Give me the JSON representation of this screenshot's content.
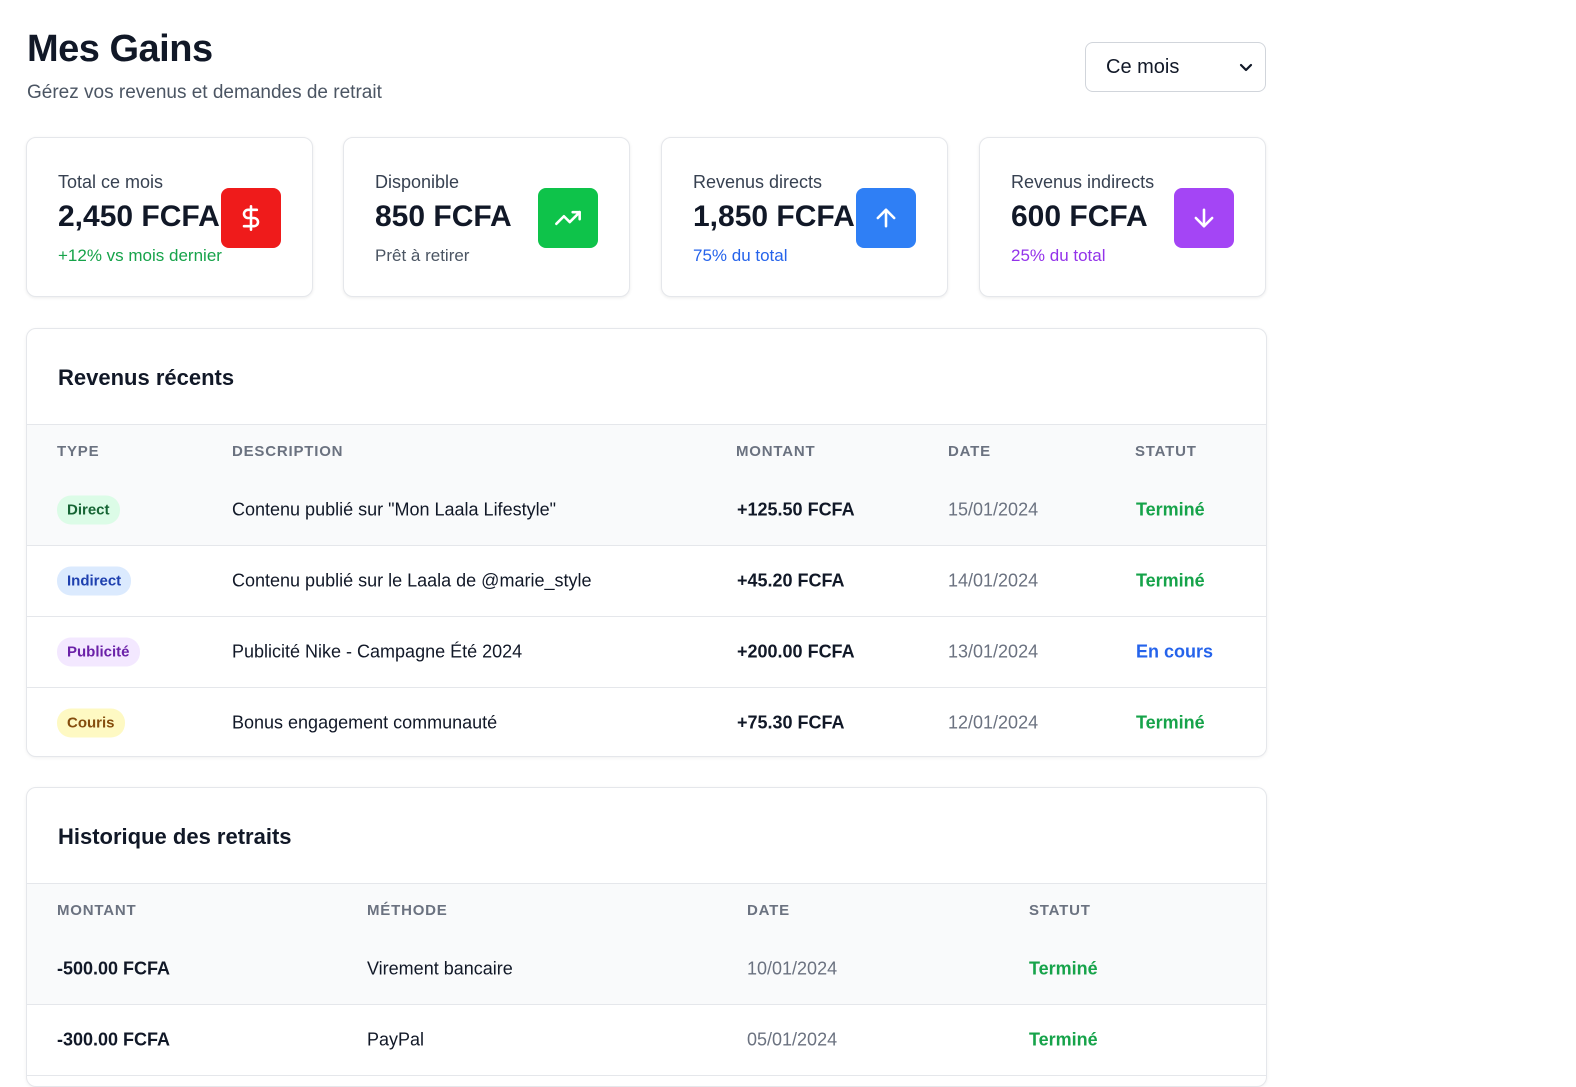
{
  "header": {
    "title": "Mes Gains",
    "subtitle": "Gérez vos revenus et demandes de retrait",
    "period_select": {
      "value": "Ce mois",
      "icon": "chevron-down-icon"
    }
  },
  "stats": [
    {
      "label": "Total ce mois",
      "value": "2,450 FCFA",
      "sub": "+12% vs mois dernier",
      "sub_color": "#16a34a",
      "icon": "dollar-icon",
      "icon_bg": "#ef1b1b"
    },
    {
      "label": "Disponible",
      "value": "850 FCFA",
      "sub": "Prêt à retirer",
      "sub_color": "#4b5563",
      "icon": "trending-up-icon",
      "icon_bg": "#0ec34a"
    },
    {
      "label": "Revenus directs",
      "value": "1,850 FCFA",
      "sub": "75% du total",
      "sub_color": "#2563eb",
      "icon": "arrow-up-icon",
      "icon_bg": "#2f7ff5"
    },
    {
      "label": "Revenus indirects",
      "value": "600 FCFA",
      "sub": "25% du total",
      "sub_color": "#9333ea",
      "icon": "arrow-down-icon",
      "icon_bg": "#a445f5"
    }
  ],
  "recent": {
    "title": "Revenus récents",
    "columns": [
      "Type",
      "Description",
      "Montant",
      "Date",
      "Statut"
    ],
    "rows": [
      {
        "type": "Direct",
        "type_bg": "#dcfce7",
        "type_color": "#166534",
        "description": "Contenu publié sur \"Mon Laala Lifestyle\"",
        "amount": "+125.50 FCFA",
        "date": "15/01/2024",
        "status": "Terminé",
        "status_color": "#16a34a"
      },
      {
        "type": "Indirect",
        "type_bg": "#dbeafe",
        "type_color": "#1e40af",
        "description": "Contenu publié sur le Laala de @marie_style",
        "amount": "+45.20 FCFA",
        "date": "14/01/2024",
        "status": "Terminé",
        "status_color": "#16a34a"
      },
      {
        "type": "Publicité",
        "type_bg": "#f3e8ff",
        "type_color": "#6b21a8",
        "description": "Publicité Nike - Campagne Été 2024",
        "amount": "+200.00 FCFA",
        "date": "13/01/2024",
        "status": "En cours",
        "status_color": "#2563eb"
      },
      {
        "type": "Couris",
        "type_bg": "#fef9c3",
        "type_color": "#854d0e",
        "description": "Bonus engagement communauté",
        "amount": "+75.30 FCFA",
        "date": "12/01/2024",
        "status": "Terminé",
        "status_color": "#16a34a"
      }
    ]
  },
  "withdrawals": {
    "title": "Historique des retraits",
    "columns": [
      "Montant",
      "Méthode",
      "Date",
      "Statut"
    ],
    "rows": [
      {
        "amount": "-500.00 FCFA",
        "method": "Virement bancaire",
        "date": "10/01/2024",
        "status": "Terminé",
        "status_color": "#16a34a"
      },
      {
        "amount": "-300.00 FCFA",
        "method": "PayPal",
        "date": "05/01/2024",
        "status": "Terminé",
        "status_color": "#16a34a"
      }
    ]
  }
}
